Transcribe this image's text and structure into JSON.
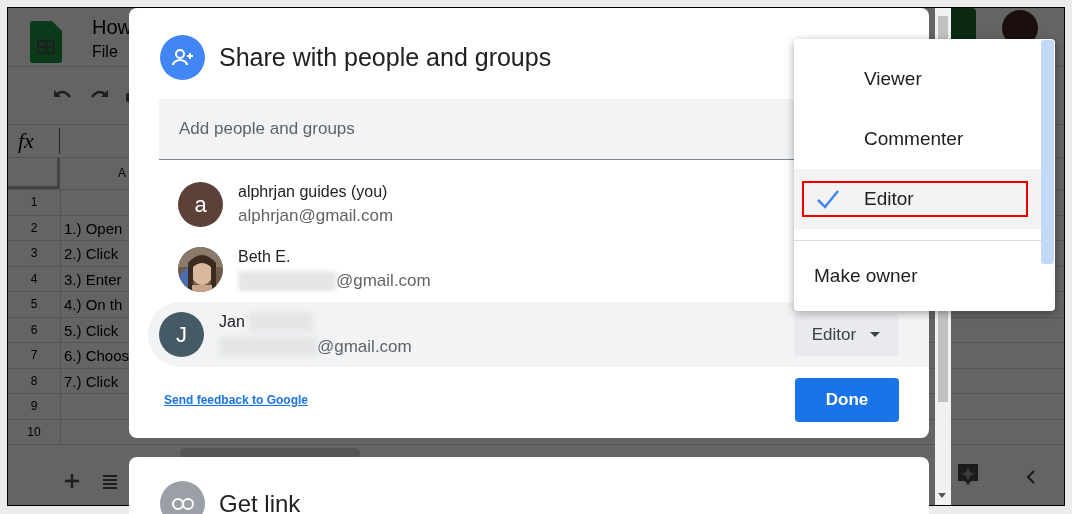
{
  "sheet": {
    "title": "How",
    "menu": [
      "File"
    ],
    "formula_label": "fx",
    "column_header": "A",
    "rows": [
      {
        "number": "1",
        "text": ""
      },
      {
        "number": "2",
        "text": "1.) Open"
      },
      {
        "number": "3",
        "text": "2.) Click"
      },
      {
        "number": "4",
        "text": "3.) Enter"
      },
      {
        "number": "5",
        "text": "4.) On th"
      },
      {
        "number": "6",
        "text": "5.) Click"
      },
      {
        "number": "7",
        "text": "6.) Choos"
      },
      {
        "number": "8",
        "text": "7.) Click"
      },
      {
        "number": "9",
        "text": ""
      },
      {
        "number": "10",
        "text": ""
      }
    ]
  },
  "share_dialog": {
    "title": "Share with people and groups",
    "search": {
      "placeholder": "Add people and groups"
    },
    "people": [
      {
        "name": "alphrjan guides (you)",
        "email": "alphrjan@gmail.com",
        "email_blurred": false,
        "name_blurred": false,
        "highlighted": false,
        "avatar": {
          "kind": "letter",
          "letter": "a",
          "color": "#5d4037"
        }
      },
      {
        "name": "Beth E.",
        "email": "@gmail.com",
        "email_blurred": true,
        "name_blurred": false,
        "highlighted": false
      },
      {
        "name": "Jan",
        "email": "@gmail.com",
        "email_blurred": true,
        "name_blurred": true,
        "highlighted": true,
        "role": "Editor",
        "avatar": {
          "kind": "letter",
          "letter": "J",
          "color": "#455a64"
        }
      }
    ],
    "feedback_link": "Send feedback to Google",
    "done_button": "Done"
  },
  "link_dialog": {
    "title": "Get link"
  },
  "role_menu": {
    "items": [
      {
        "kind": "role",
        "label": "Viewer",
        "selected": false,
        "annotated": false
      },
      {
        "kind": "role",
        "label": "Commenter",
        "selected": false,
        "annotated": false
      },
      {
        "kind": "role",
        "label": "Editor",
        "selected": true,
        "annotated": true
      },
      {
        "kind": "action",
        "label": "Make owner",
        "selected": false,
        "annotated": false
      }
    ]
  }
}
